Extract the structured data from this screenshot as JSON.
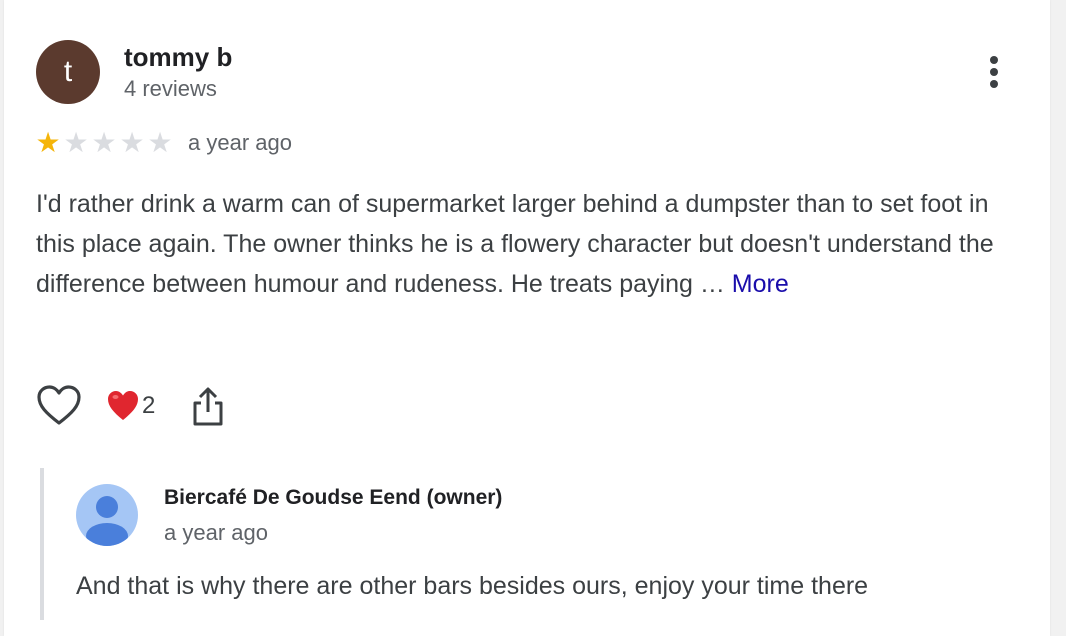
{
  "review": {
    "avatar_letter": "t",
    "avatar_color": "#5b3a2e",
    "reviewer_name": "tommy b",
    "review_count": "4 reviews",
    "rating": 1,
    "rating_max": 5,
    "date": "a year ago",
    "text": "I'd rather drink a warm can of supermarket larger behind a dumpster than to set foot in this place again. The owner thinks he is a flowery character but doesn't understand the difference between humour and rudeness. He treats paying … ",
    "more_label": "More",
    "reaction_emoji": "heart",
    "reaction_count": "2"
  },
  "owner_reply": {
    "name": "Biercafé De Goudse Eend (owner)",
    "date": "a year ago",
    "text": "And that is why there are other bars besides ours, enjoy your time there"
  },
  "icons": {
    "menu": "more-vert-icon",
    "like": "heart-outline-icon",
    "reaction": "red-heart-emoji-icon",
    "share": "share-icon",
    "owner_avatar": "person-icon"
  },
  "colors": {
    "star_filled": "#f5b50a",
    "star_empty": "#dadce0",
    "link": "#1a0dab",
    "reaction_red": "#e0262f"
  }
}
